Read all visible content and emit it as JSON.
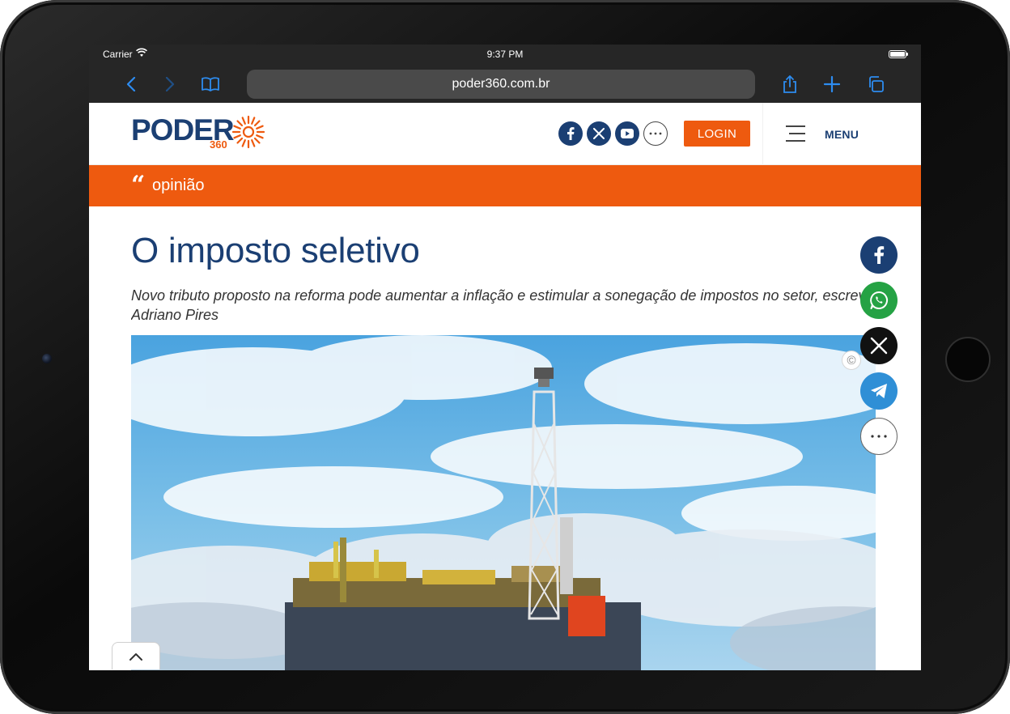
{
  "statusbar": {
    "carrier": "Carrier",
    "time": "9:37 PM"
  },
  "browser": {
    "url": "poder360.com.br",
    "icons": [
      "back-icon",
      "forward-icon",
      "bookmarks-icon",
      "share-icon",
      "new-tab-icon",
      "tabs-icon"
    ]
  },
  "site": {
    "logo": {
      "word": "PODER",
      "number": "360"
    },
    "social": [
      "facebook-icon",
      "x-icon",
      "youtube-icon",
      "more-icon"
    ],
    "login_label": "LOGIN",
    "menu_label": "MENU",
    "section": "opinião"
  },
  "article": {
    "title": "O imposto seletivo",
    "subtitle": "Novo tributo proposto na reforma pode aumentar a inflação e estimular a sonegação de impostos no setor, escreve Adriano Pires",
    "image_credit_icon": "©"
  },
  "share_bar": [
    "facebook-icon",
    "whatsapp-icon",
    "x-icon",
    "telegram-icon",
    "more-icon"
  ],
  "colors": {
    "brand_blue": "#1b3f73",
    "brand_orange": "#ee5a0f",
    "whatsapp": "#25a244",
    "telegram": "#2f8fd6"
  }
}
